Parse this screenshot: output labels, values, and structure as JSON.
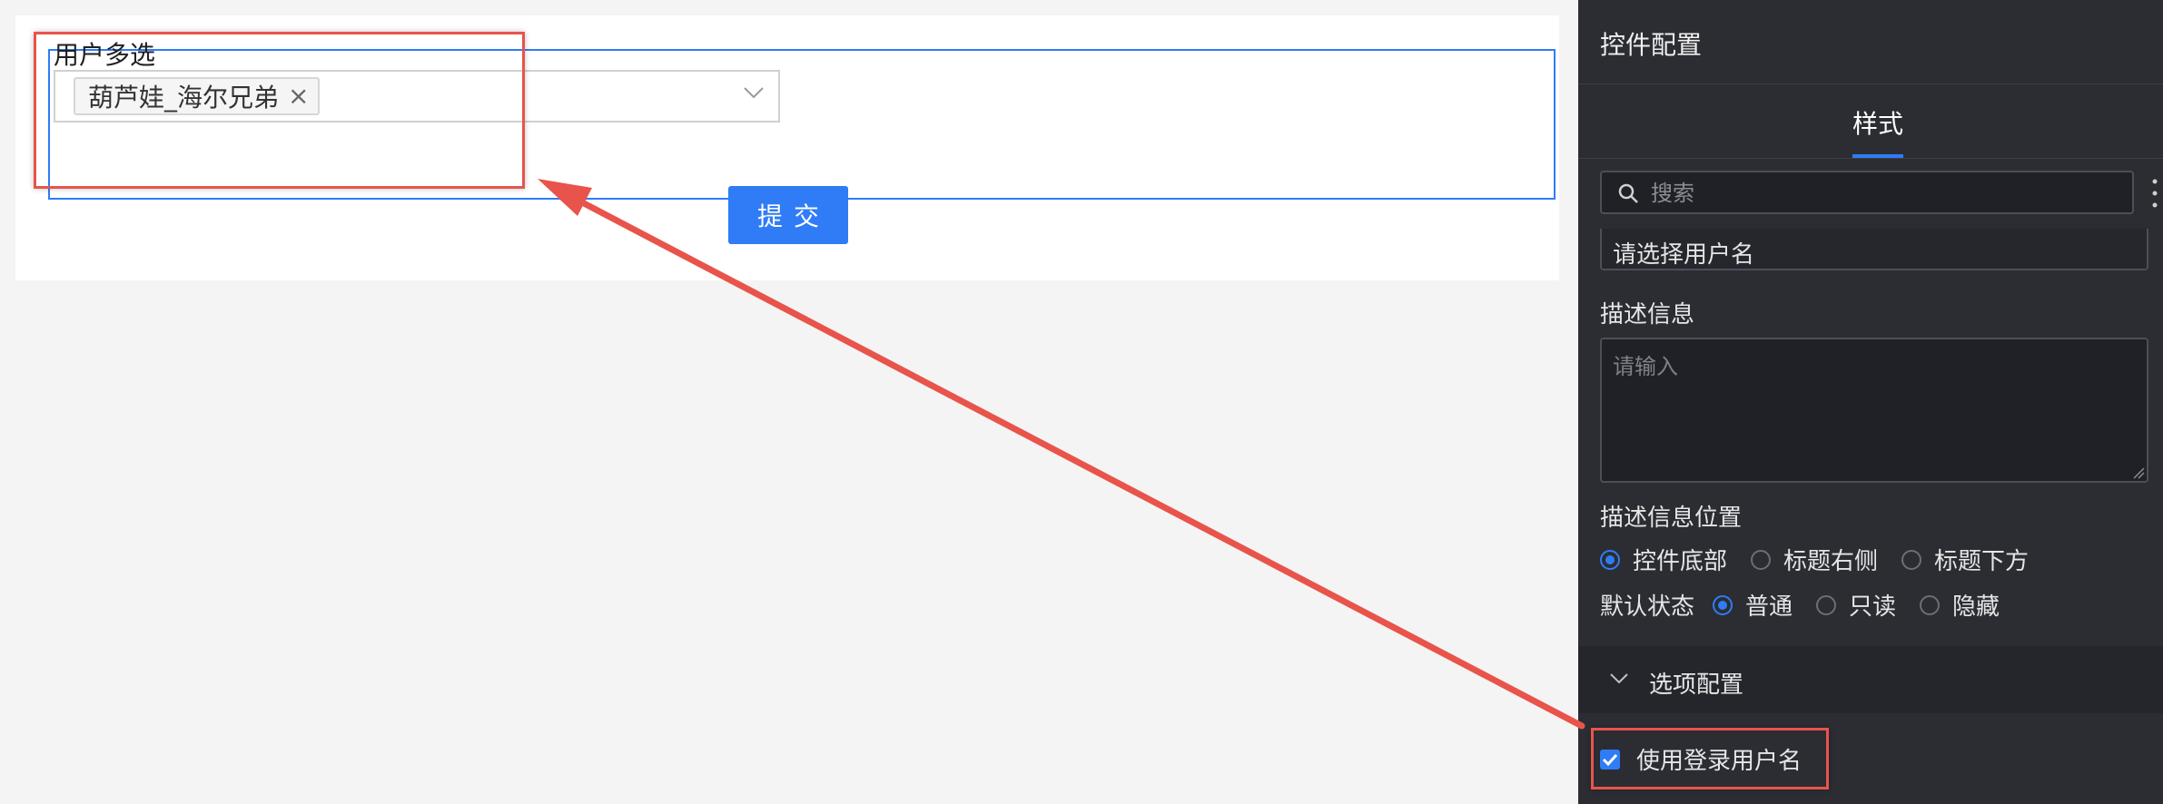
{
  "form": {
    "field_label": "用户多选",
    "selected_tag": "葫芦娃_海尔兄弟",
    "tag_close": "×",
    "submit_label": "提交"
  },
  "panel": {
    "title": "控件配置",
    "tab": "样式",
    "search_placeholder": "搜索",
    "value_field": "请选择用户名",
    "desc_label": "描述信息",
    "desc_placeholder": "请输入",
    "position_label": "描述信息位置",
    "position_options": [
      "控件底部",
      "标题右侧",
      "标题下方"
    ],
    "position_selected": "控件底部",
    "state_label": "默认状态",
    "state_options": [
      "普通",
      "只读",
      "隐藏"
    ],
    "state_selected": "普通",
    "section_title": "选项配置",
    "checkbox_label": "使用登录用户名",
    "checkbox_checked": true
  },
  "icons": [
    "chevron-down-icon",
    "search-icon",
    "more-vertical-icon",
    "resize-grip-icon",
    "check-icon"
  ],
  "colors": {
    "accent": "#2f7cf6",
    "panel_bg": "#2b2d33",
    "canvas_bg": "#f4f4f4",
    "annotation": "#e8544b"
  }
}
